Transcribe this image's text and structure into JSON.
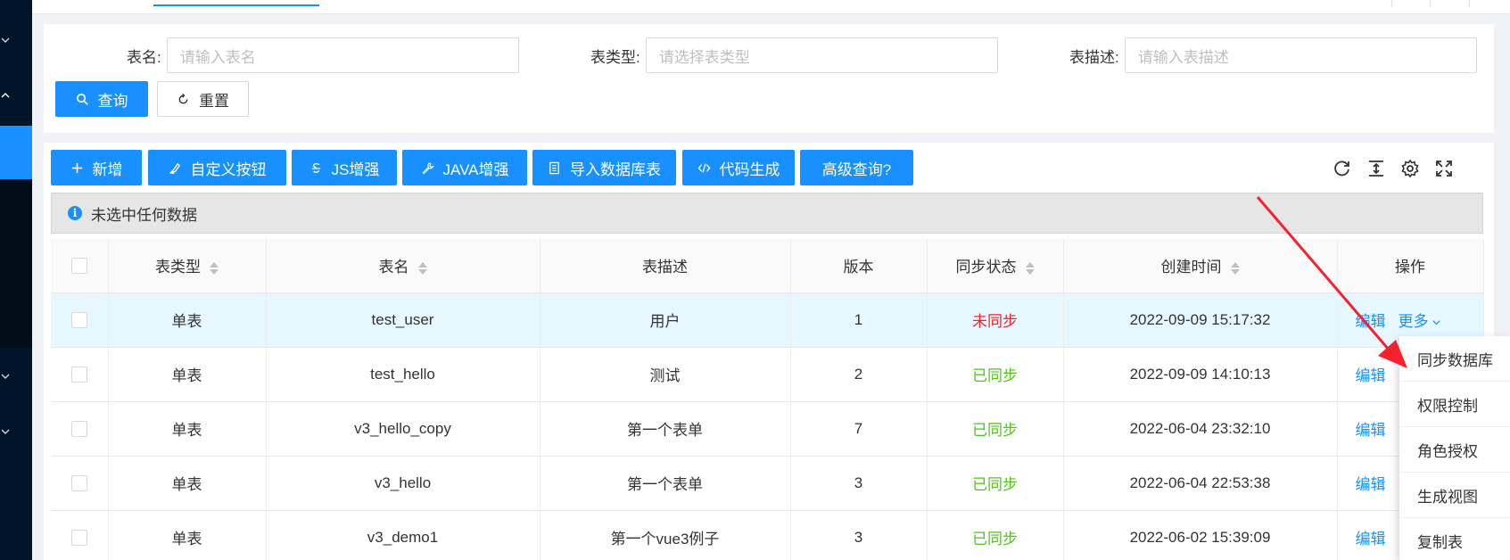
{
  "search": {
    "table_name_label": "表名:",
    "table_name_placeholder": "请输入表名",
    "table_type_label": "表类型:",
    "table_type_placeholder": "请选择表类型",
    "table_desc_label": "表描述:",
    "table_desc_placeholder": "请输入表描述",
    "query_label": "查询",
    "reset_label": "重置"
  },
  "toolbar": {
    "add_label": "新增",
    "custom_button_label": "自定义按钮",
    "js_label": "JS增强",
    "java_label": "JAVA增强",
    "import_label": "导入数据库表",
    "codegen_label": "代码生成",
    "advanced_label": "高级查询?"
  },
  "alert": {
    "text": "未选中任何数据"
  },
  "columns": [
    "表类型",
    "表名",
    "表描述",
    "版本",
    "同步状态",
    "创建时间",
    "操作"
  ],
  "rows": [
    {
      "type": "单表",
      "name": "test_user",
      "desc": "用户",
      "version": "1",
      "status": "未同步",
      "status_color": "#f5222d",
      "created": "2022-09-09 15:17:32",
      "edit": "编辑",
      "more": "更多"
    },
    {
      "type": "单表",
      "name": "test_hello",
      "desc": "测试",
      "version": "2",
      "status": "已同步",
      "status_color": "#52c41a",
      "created": "2022-09-09 14:10:13",
      "edit": "编辑"
    },
    {
      "type": "单表",
      "name": "v3_hello_copy",
      "desc": "第一个表单",
      "version": "7",
      "status": "已同步",
      "status_color": "#52c41a",
      "created": "2022-06-04 23:32:10",
      "edit": "编辑"
    },
    {
      "type": "单表",
      "name": "v3_hello",
      "desc": "第一个表单",
      "version": "3",
      "status": "已同步",
      "status_color": "#52c41a",
      "created": "2022-06-04 22:53:38",
      "edit": "编辑"
    },
    {
      "type": "单表",
      "name": "v3_demo1",
      "desc": "第一个vue3例子",
      "version": "3",
      "status": "已同步",
      "status_color": "#52c41a",
      "created": "2022-06-02 15:39:09",
      "edit": "编辑"
    }
  ],
  "dropdown": {
    "items": [
      "同步数据库",
      "权限控制",
      "角色授权",
      "生成视图",
      "复制表"
    ]
  },
  "colors": {
    "primary": "#1890ff",
    "sidebar": "#001529",
    "annotation_arrow": "#f5222d"
  }
}
